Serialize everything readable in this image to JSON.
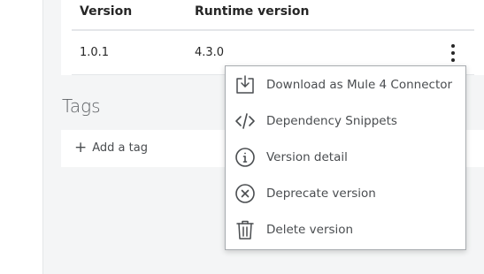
{
  "versions_table": {
    "columns": [
      "Version",
      "Runtime version"
    ],
    "rows": [
      {
        "version": "1.0.1",
        "runtime_version": "4.3.0"
      }
    ]
  },
  "tags": {
    "title": "Tags",
    "add_tag_label": "Add a tag"
  },
  "menu": {
    "items": [
      {
        "label": "Download as Mule 4 Connector",
        "icon": "download-icon"
      },
      {
        "label": "Dependency Snippets",
        "icon": "code-icon"
      },
      {
        "label": "Version detail",
        "icon": "info-icon"
      },
      {
        "label": "Deprecate version",
        "icon": "x-circle-icon"
      },
      {
        "label": "Delete version",
        "icon": "trash-icon"
      }
    ]
  },
  "colors": {
    "text": "#262626",
    "muted_text": "#4a4d50",
    "panel_bg": "#f4f5f6",
    "border": "#a8acb0"
  }
}
